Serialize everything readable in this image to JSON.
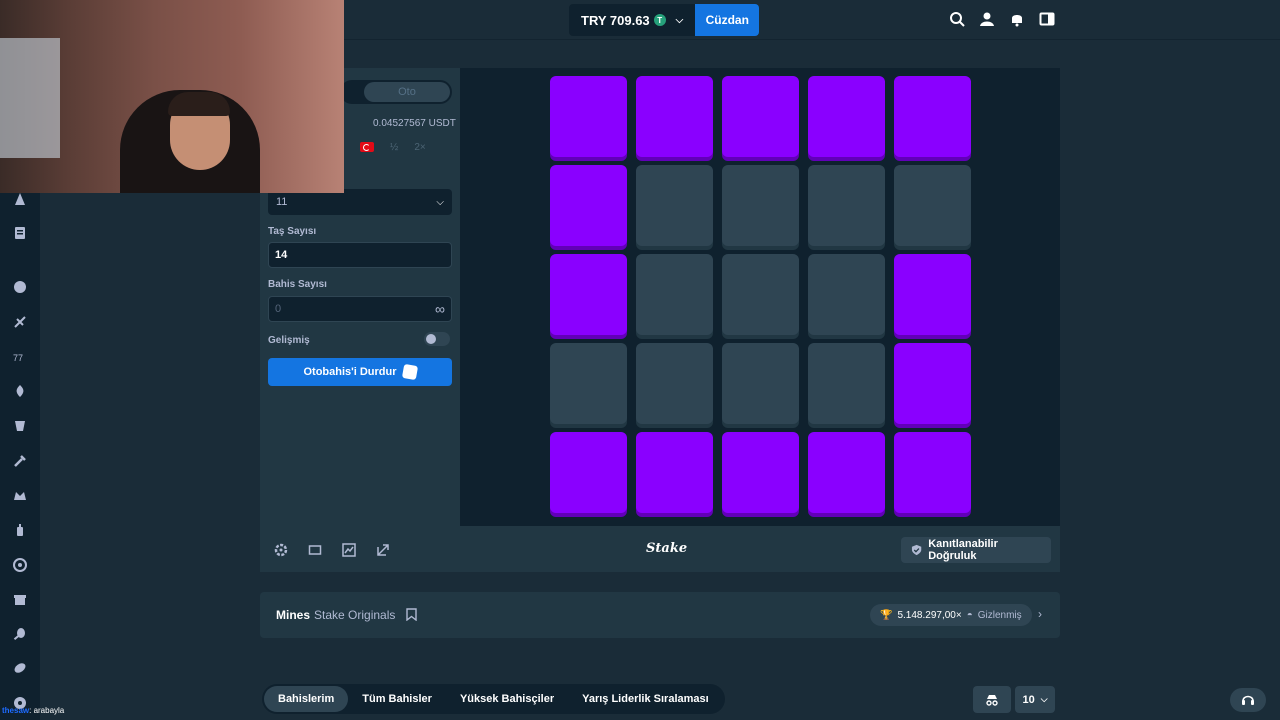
{
  "header": {
    "balance": "TRY 709.63",
    "currency_badge": "T",
    "wallet_label": "Cüzdan",
    "icons": [
      "search-icon",
      "user-icon",
      "bell-icon",
      "sidebar-toggle-icon"
    ]
  },
  "sidebar": {
    "icons": [
      "sports-icon",
      "casino-icon",
      "originals-icon",
      "slots-icon",
      "live-icon",
      "hot-icon",
      "table-icon",
      "tools-icon",
      "crown-icon",
      "bottle-icon",
      "soccer-icon",
      "gift-icon",
      "tennis-icon",
      "ball-icon",
      "football-icon"
    ]
  },
  "controls": {
    "tab_auto": "Oto",
    "amount_usd": "0.04527567 USDT",
    "half_label": "½",
    "double_label": "2×",
    "mines_select_value": "11",
    "gems_label": "Taş Sayısı",
    "gems_value": "14",
    "bets_label": "Bahis Sayısı",
    "bets_value": "0",
    "advanced_label": "Gelişmiş",
    "stop_button": "Otobahis'i Durdur"
  },
  "grid": {
    "tiles": [
      "purple",
      "purple",
      "purple",
      "purple",
      "purple",
      "purple",
      "empty",
      "empty",
      "empty",
      "empty",
      "purple",
      "empty",
      "empty",
      "empty",
      "purple",
      "empty",
      "empty",
      "empty",
      "empty",
      "purple",
      "purple",
      "purple",
      "purple",
      "purple",
      "purple"
    ],
    "colors": {
      "purple": "#8a00ff",
      "empty": "#2f4553"
    }
  },
  "game_footer": {
    "logo": "Stake",
    "fairness_button": "Kanıtlanabilir Doğruluk"
  },
  "info_bar": {
    "title": "Mines",
    "subtitle": "Stake Originals",
    "prize": "5.148.297,00×",
    "hidden_label": "Gizlenmiş"
  },
  "bets": {
    "tabs": [
      "Bahislerim",
      "Tüm Bahisler",
      "Yüksek Bahisçiler",
      "Yarış Liderlik Sıralaması"
    ],
    "count": "10"
  },
  "chat": {
    "user": "thesaw",
    "message": ": arabayla"
  }
}
